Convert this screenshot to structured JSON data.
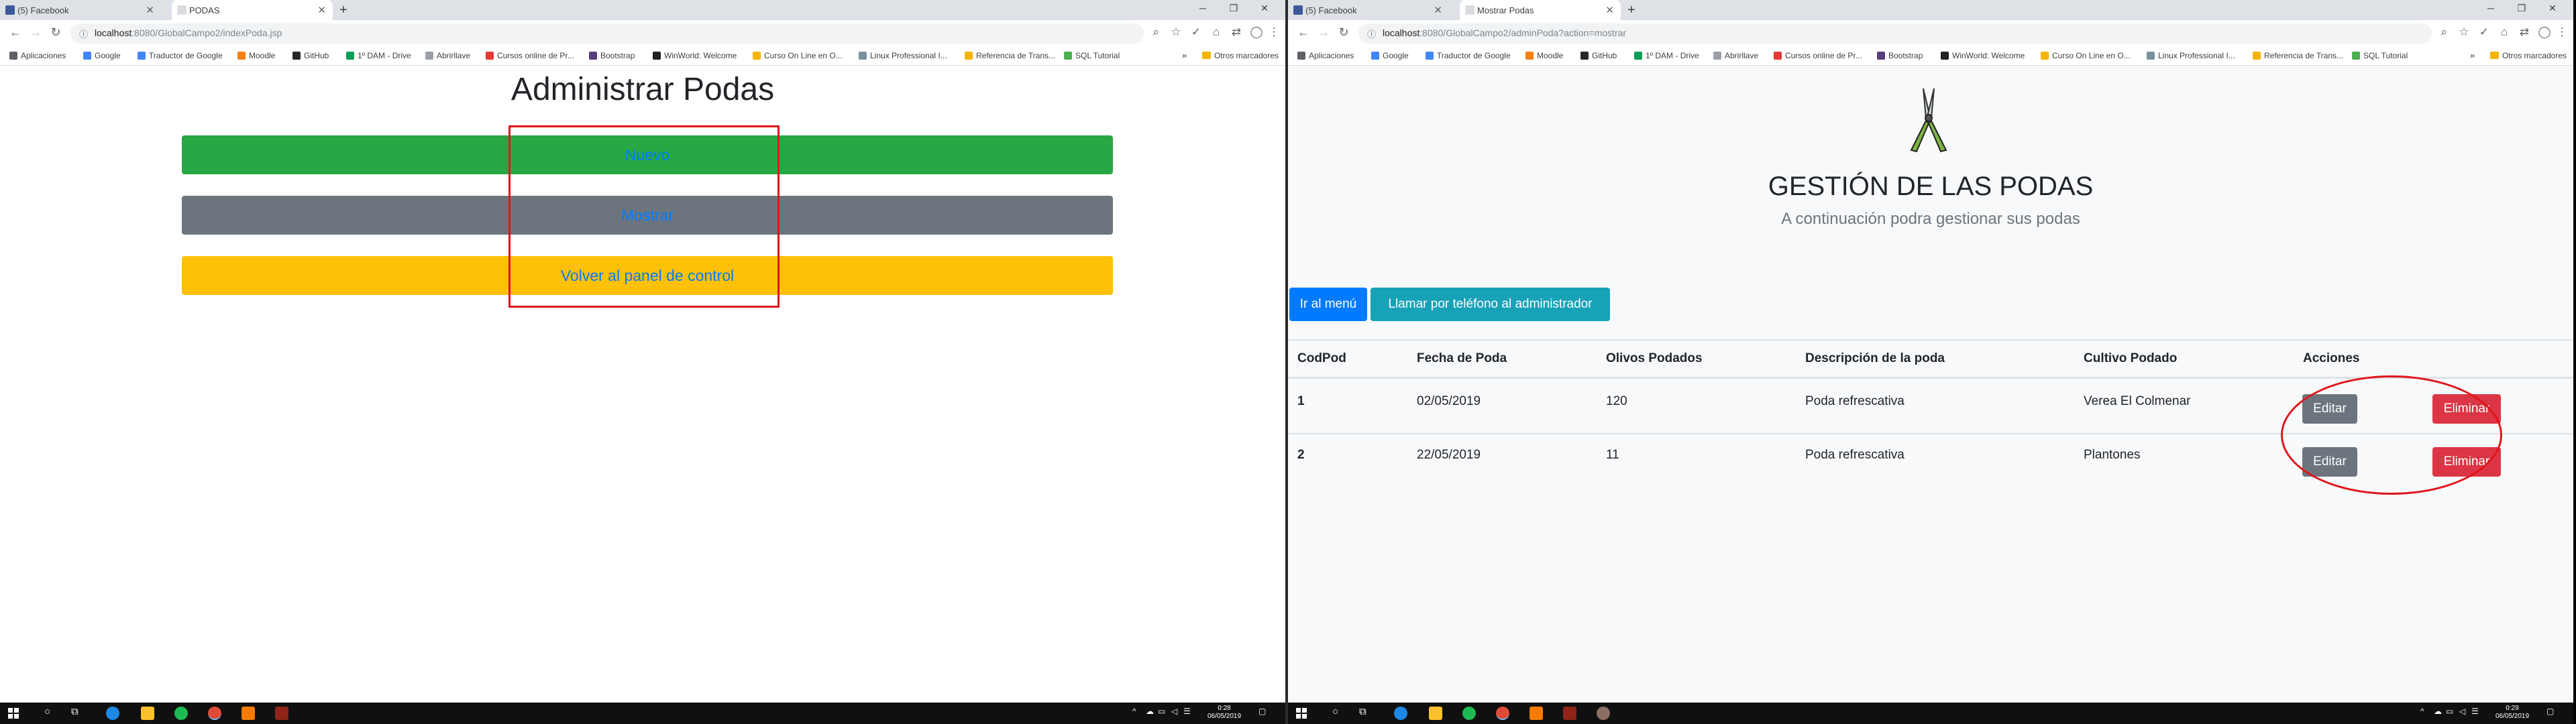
{
  "left": {
    "tabs": [
      {
        "label": "(5) Facebook",
        "color": "#3b5998"
      },
      {
        "label": "PODAS",
        "color": "#9aa0a6"
      }
    ],
    "url_host": "localhost",
    "url_path": ":8080/GlobalCampo2/indexPoda.jsp",
    "bookmarks": [
      {
        "label": "Aplicaciones",
        "color": "#5f6368"
      },
      {
        "label": "Google",
        "color": "#4285f4"
      },
      {
        "label": "Traductor de Google",
        "color": "#4285f4"
      },
      {
        "label": "Moodle",
        "color": "#f98012"
      },
      {
        "label": "GitHub",
        "color": "#24292e"
      },
      {
        "label": "1º DAM - Drive",
        "color": "#0f9d58"
      },
      {
        "label": "Abrirllave",
        "color": "#9aa0a6"
      },
      {
        "label": "Cursos online de Pr...",
        "color": "#e53935"
      },
      {
        "label": "Bootstrap",
        "color": "#563d7c"
      },
      {
        "label": "WinWorld: Welcome",
        "color": "#222222"
      },
      {
        "label": "Curso On Line en O...",
        "color": "#f4b400"
      },
      {
        "label": "Linux Professional I...",
        "color": "#78909c"
      },
      {
        "label": "Referencia de Trans...",
        "color": "#f4b400"
      },
      {
        "label": "SQL Tutorial",
        "color": "#4caf50"
      }
    ],
    "bookmarks_more": "»",
    "other_bookmarks": "Otros marcadores",
    "page": {
      "title": "Administrar Podas",
      "buttons": [
        {
          "label": "Nuevo",
          "bg": "#28a745"
        },
        {
          "label": "Mostrar",
          "bg": "#6c757d"
        },
        {
          "label": "Volver al panel de control",
          "bg": "#ffc107"
        }
      ]
    },
    "clock": {
      "time": "0:28",
      "date": "06/05/2019"
    }
  },
  "right": {
    "tabs": [
      {
        "label": "(5) Facebook",
        "color": "#3b5998"
      },
      {
        "label": "Mostrar Podas",
        "color": "#9aa0a6"
      }
    ],
    "url_host": "localhost",
    "url_path": ":8080/GlobalCampo2/adminPoda?action=mostrar",
    "bookmarks": [
      {
        "label": "Aplicaciones",
        "color": "#5f6368"
      },
      {
        "label": "Google",
        "color": "#4285f4"
      },
      {
        "label": "Traductor de Google",
        "color": "#4285f4"
      },
      {
        "label": "Moodle",
        "color": "#f98012"
      },
      {
        "label": "GitHub",
        "color": "#24292e"
      },
      {
        "label": "1º DAM - Drive",
        "color": "#0f9d58"
      },
      {
        "label": "Abrirllave",
        "color": "#9aa0a6"
      },
      {
        "label": "Cursos online de Pr...",
        "color": "#e53935"
      },
      {
        "label": "Bootstrap",
        "color": "#563d7c"
      },
      {
        "label": "WinWorld: Welcome",
        "color": "#222222"
      },
      {
        "label": "Curso On Line en O...",
        "color": "#f4b400"
      },
      {
        "label": "Linux Professional I...",
        "color": "#78909c"
      },
      {
        "label": "Referencia de Trans...",
        "color": "#f4b400"
      },
      {
        "label": "SQL Tutorial",
        "color": "#4caf50"
      }
    ],
    "bookmarks_more": "»",
    "other_bookmarks": "Otros marcadores",
    "page": {
      "title": "GESTIÓN DE LAS PODAS",
      "subtitle": "A continuación podra gestionar sus podas",
      "menu_button": "Ir al menú",
      "call_button": "Llamar por teléfono al administrador",
      "columns": [
        "CodPod",
        "Fecha de Poda",
        "Olivos Podados",
        "Descripción de la poda",
        "Cultivo Podado",
        "Acciones"
      ],
      "rows": [
        {
          "cod": "1",
          "fecha": "02/05/2019",
          "olivos": "120",
          "descripcion": "Poda refrescativa",
          "cultivo": "Verea El Colmenar"
        },
        {
          "cod": "2",
          "fecha": "22/05/2019",
          "olivos": "11",
          "descripcion": "Poda refrescativa",
          "cultivo": "Plantones"
        }
      ],
      "edit_label": "Editar",
      "delete_label": "Eliminar"
    },
    "clock": {
      "time": "0:29",
      "date": "06/05/2019"
    }
  },
  "colors": {
    "primary": "#007bff",
    "info": "#17a2b8",
    "secondary": "#6c757d",
    "danger": "#dc3545",
    "annotation": "#e0161b"
  }
}
